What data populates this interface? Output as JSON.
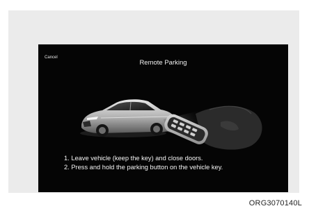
{
  "screen": {
    "cancel_label": "Cancel",
    "title": "Remote Parking",
    "instructions": [
      "1. Leave vehicle (keep the key) and close doors.",
      "2. Press and hold the parking button on the vehicle key."
    ]
  },
  "figure": {
    "code": "ORG3070140L"
  },
  "icons": {
    "car": "car-illustration",
    "key": "key-fob-illustration"
  },
  "colors": {
    "screen_background": "#050505",
    "panel_background": "#ebebeb",
    "text": "#f2f2f2"
  }
}
